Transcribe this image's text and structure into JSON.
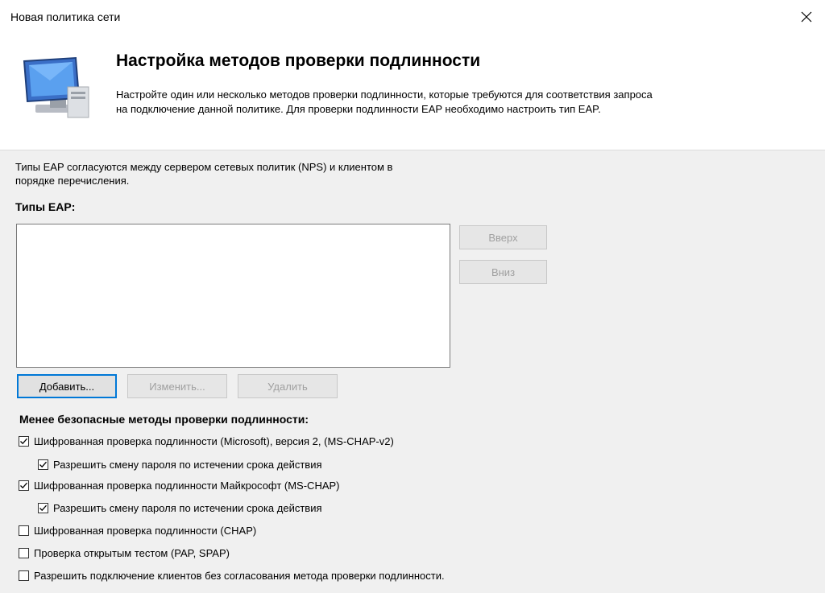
{
  "window": {
    "title": "Новая политика сети"
  },
  "header": {
    "title": "Настройка методов проверки подлинности",
    "description_line1": "Настройте один или несколько методов проверки подлинности, которые требуются для соответствия запроса",
    "description_line2": "на подключение данной политике. Для проверки подлинности EAP необходимо настроить тип EAP.",
    "icon": "computer-icon"
  },
  "eap": {
    "intro_line1": "Типы EAP согласуются между сервером сетевых политик (NPS) и клиентом в",
    "intro_line2": "порядке перечисления.",
    "label": "Типы EAP:",
    "items": [],
    "up_label": "Вверх",
    "down_label": "Вниз",
    "add_label": "Добавить...",
    "edit_label": "Изменить...",
    "delete_label": "Удалить"
  },
  "less_secure": {
    "title": "Менее безопасные методы проверки подлинности:",
    "options": [
      {
        "label": "Шифрованная проверка подлинности (Microsoft), версия 2, (MS-CHAP-v2)",
        "checked": true
      },
      {
        "label": "Разрешить смену пароля по истечении срока действия",
        "checked": true
      },
      {
        "label": "Шифрованная проверка подлинности Майкрософт (MS-CHAP)",
        "checked": true
      },
      {
        "label": "Разрешить смену пароля по истечении срока действия",
        "checked": true
      },
      {
        "label": "Шифрованная проверка подлинности (CHAP)",
        "checked": false
      },
      {
        "label": "Проверка открытым тестом (PAP, SPAP)",
        "checked": false
      },
      {
        "label": "Разрешить подключение клиентов без согласования метода проверки подлинности.",
        "checked": false
      }
    ]
  }
}
